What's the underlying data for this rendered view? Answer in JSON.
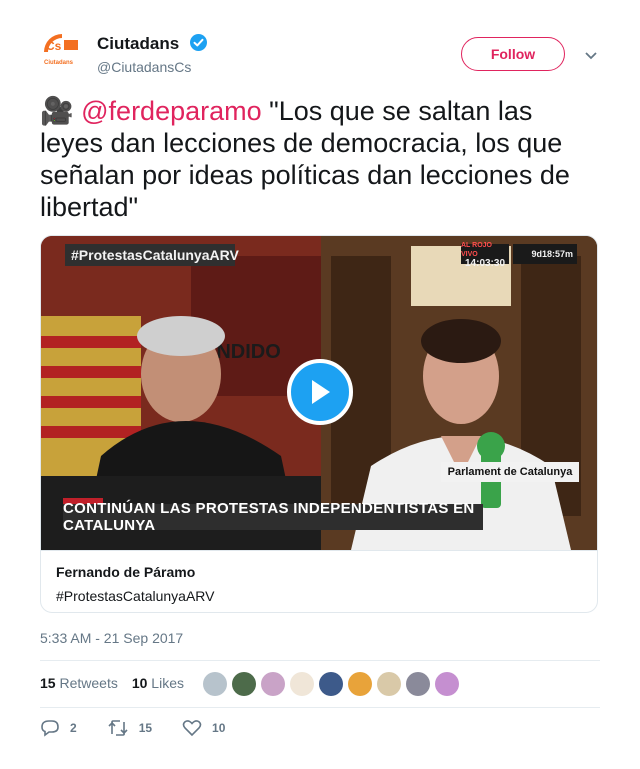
{
  "account": {
    "name": "Ciutadans",
    "handle": "@CiutadansCs",
    "avatar_text": "Ciutadans",
    "follow_label": "Follow"
  },
  "tweet": {
    "emoji": "🎥",
    "mention": "@ferdeparamo",
    "text": " \"Los que se saltan las leyes dan lecciones de democracia, los que señalan por ideas políticas dan lecciones de libertad\""
  },
  "video": {
    "hashtag_overlay": "#ProtestasCatalunyaARV",
    "show_overlay_top": "AL ROJO VIVO",
    "clock": "14:03:30",
    "brand_text": "9d18:57m",
    "ticker": "CONTINÚAN LAS PROTESTAS INDEPENDENTISTAS EN CATALUNYA",
    "rojo_badge": "AL ROJO VIVO",
    "location": "Parlament de Catalunya"
  },
  "card": {
    "title": "Fernando de Páramo",
    "description": "#ProtestasCatalunyaARV"
  },
  "meta": {
    "timestamp": "5:33 AM - 21 Sep 2017",
    "retweets_count": "15",
    "retweets_label": "Retweets",
    "likes_count": "10",
    "likes_label": "Likes"
  },
  "actions": {
    "reply_count": "2",
    "retweet_count": "15",
    "like_count": "10"
  },
  "colors": {
    "accent": "#e0245e",
    "link": "#1da1f2",
    "muted": "#657786"
  },
  "liker_colors": [
    "#b7c3cc",
    "#4d6b4a",
    "#c9a3c7",
    "#f0e6d8",
    "#3d5a8a",
    "#e8a33a",
    "#d9c9a8",
    "#8a8a9a",
    "#c58fd0"
  ]
}
